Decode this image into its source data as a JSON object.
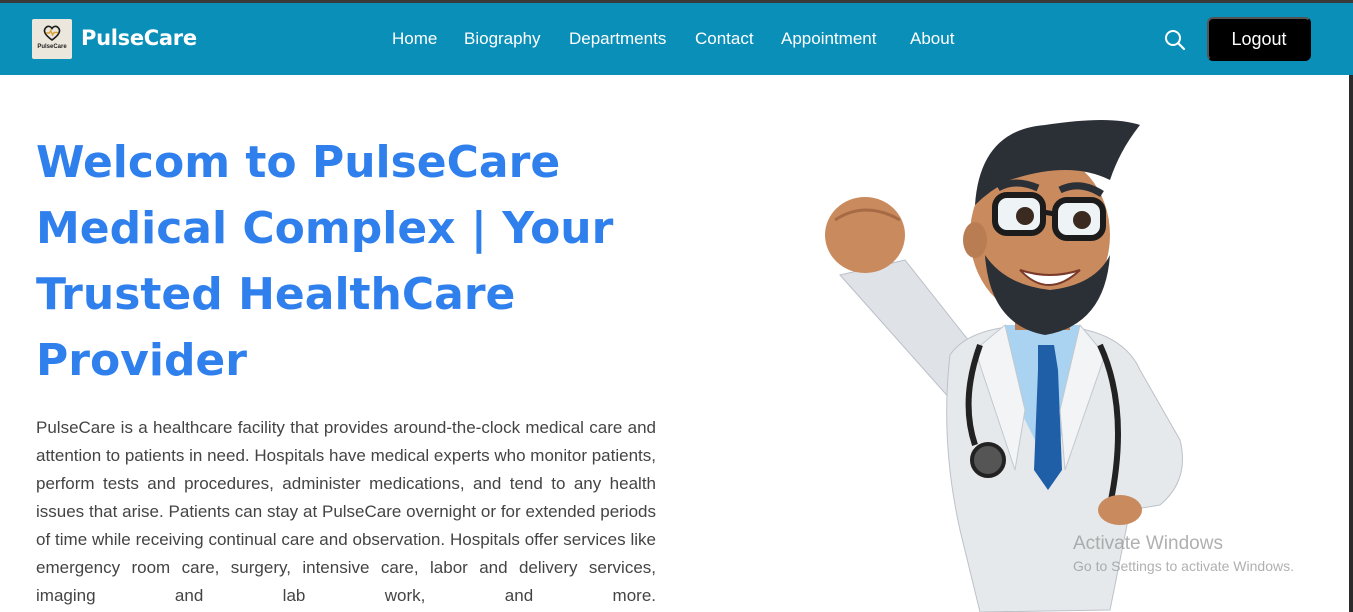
{
  "brand": {
    "name": "PulseCare",
    "logo_text": "PulseCare",
    "logo_icon": "heart-pulse-icon"
  },
  "nav": {
    "links": [
      "Home",
      "Biography",
      "Departments",
      "Contact",
      "Appointment",
      "About"
    ],
    "search_icon": "search-icon",
    "logout_label": "Logout"
  },
  "hero": {
    "title": "Welcom to PulseCare Medical Complex | Your Trusted HealthCare Provider",
    "paragraph": "PulseCare is a healthcare facility that provides around-the-clock medical care and attention to patients in need. Hospitals have medical experts who monitor patients, perform tests and procedures, administer medications, and tend to any health issues that arise. Patients can stay at PulseCare overnight or for extended periods of time while receiving continual care and observation. Hospitals offer services like emergency room care, surgery, intensive care, labor and delivery services, imaging and lab work, and more."
  },
  "watermark": {
    "line1": "Activate Windows",
    "line2": "Go to Settings to activate Windows."
  },
  "colors": {
    "navbar": "#0a8fb8",
    "title": "#2f80ed",
    "logout_bg": "#000000"
  }
}
